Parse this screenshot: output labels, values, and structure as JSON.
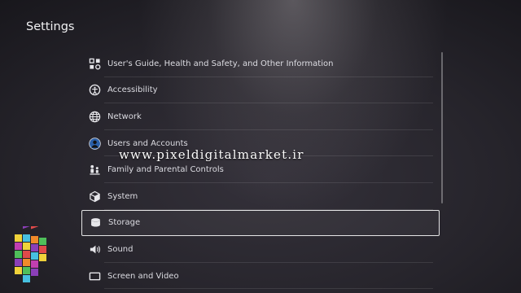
{
  "header": {
    "title": "Settings"
  },
  "menu": {
    "items": [
      {
        "label": "User's Guide, Health and Safety, and Other Information",
        "icon": "info-guide-icon"
      },
      {
        "label": "Accessibility",
        "icon": "accessibility-icon"
      },
      {
        "label": "Network",
        "icon": "globe-icon"
      },
      {
        "label": "Users and Accounts",
        "icon": "user-avatar-icon"
      },
      {
        "label": "Family and Parental Controls",
        "icon": "family-icon"
      },
      {
        "label": "System",
        "icon": "cube-icon"
      },
      {
        "label": "Storage",
        "icon": "storage-icon",
        "selected": true
      },
      {
        "label": "Sound",
        "icon": "speaker-icon"
      },
      {
        "label": "Screen and Video",
        "icon": "screen-icon"
      }
    ]
  },
  "watermark": {
    "text": "www.pixeldigitalmarket.ir"
  },
  "colors": {
    "background": "#26242b",
    "text": "#dcdce2",
    "selection_border": "#ffffff"
  }
}
